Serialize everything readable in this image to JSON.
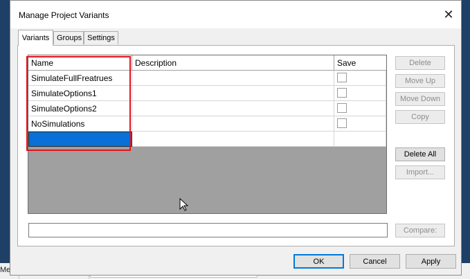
{
  "window": {
    "title": "Manage Project Variants",
    "close_glyph": "✕"
  },
  "tabs": [
    {
      "label": "Variants",
      "active": true
    },
    {
      "label": "Groups",
      "active": false
    },
    {
      "label": "Settings",
      "active": false
    }
  ],
  "grid": {
    "columns": [
      "Name",
      "Description",
      "Save"
    ],
    "rows": [
      {
        "name": "SimulateFullFreatrues",
        "description": "",
        "save": false
      },
      {
        "name": "SimulateOptions1",
        "description": "",
        "save": false
      },
      {
        "name": "SimulateOptions2",
        "description": "",
        "save": false
      },
      {
        "name": "NoSimulations",
        "description": "",
        "save": false
      },
      {
        "name": "",
        "description": "",
        "selected": true
      }
    ]
  },
  "side_buttons": {
    "delete": "Delete",
    "move_up": "Move Up",
    "move_down": "Move Down",
    "copy": "Copy",
    "delete_all": "Delete All",
    "import": "Import..."
  },
  "compare": {
    "value": "",
    "button": "Compare:"
  },
  "footer": {
    "ok": "OK",
    "cancel": "Cancel",
    "apply": "Apply"
  },
  "background": {
    "partial_text": "Mess"
  },
  "colors": {
    "highlight": "#e0141e",
    "selection": "#0a6fd6",
    "grid_empty": "#a0a0a0",
    "focus_border": "#0078d7"
  }
}
